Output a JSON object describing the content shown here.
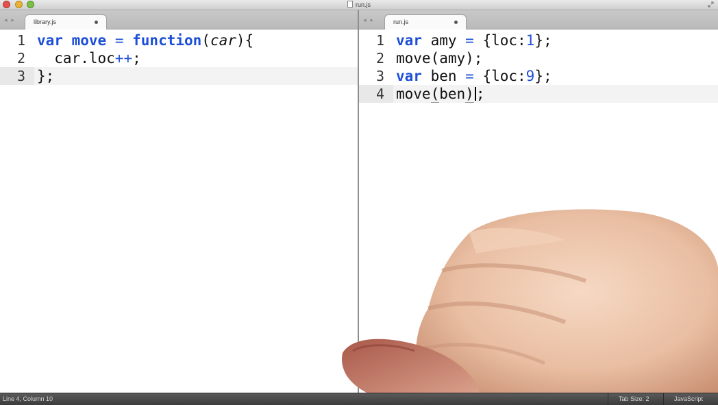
{
  "window": {
    "title": "run.js"
  },
  "left_pane": {
    "tab_label": "library.js",
    "lines": [
      {
        "num": "1"
      },
      {
        "num": "2"
      },
      {
        "num": "3"
      }
    ]
  },
  "right_pane": {
    "tab_label": "run.js",
    "lines": [
      {
        "num": "1"
      },
      {
        "num": "2"
      },
      {
        "num": "3"
      },
      {
        "num": "4"
      }
    ]
  },
  "statusbar": {
    "position": "Line 4, Column 10",
    "tab_size": "Tab Size: 2",
    "syntax": "JavaScript"
  },
  "colors": {
    "keyword": "#1d4fd6",
    "background": "#ffffff",
    "statusbar": "#3c3c3c"
  },
  "icons": [
    "close-window-icon",
    "minimize-window-icon",
    "maximize-window-icon",
    "document-icon",
    "fullscreen-icon",
    "tab-close-icon"
  ]
}
